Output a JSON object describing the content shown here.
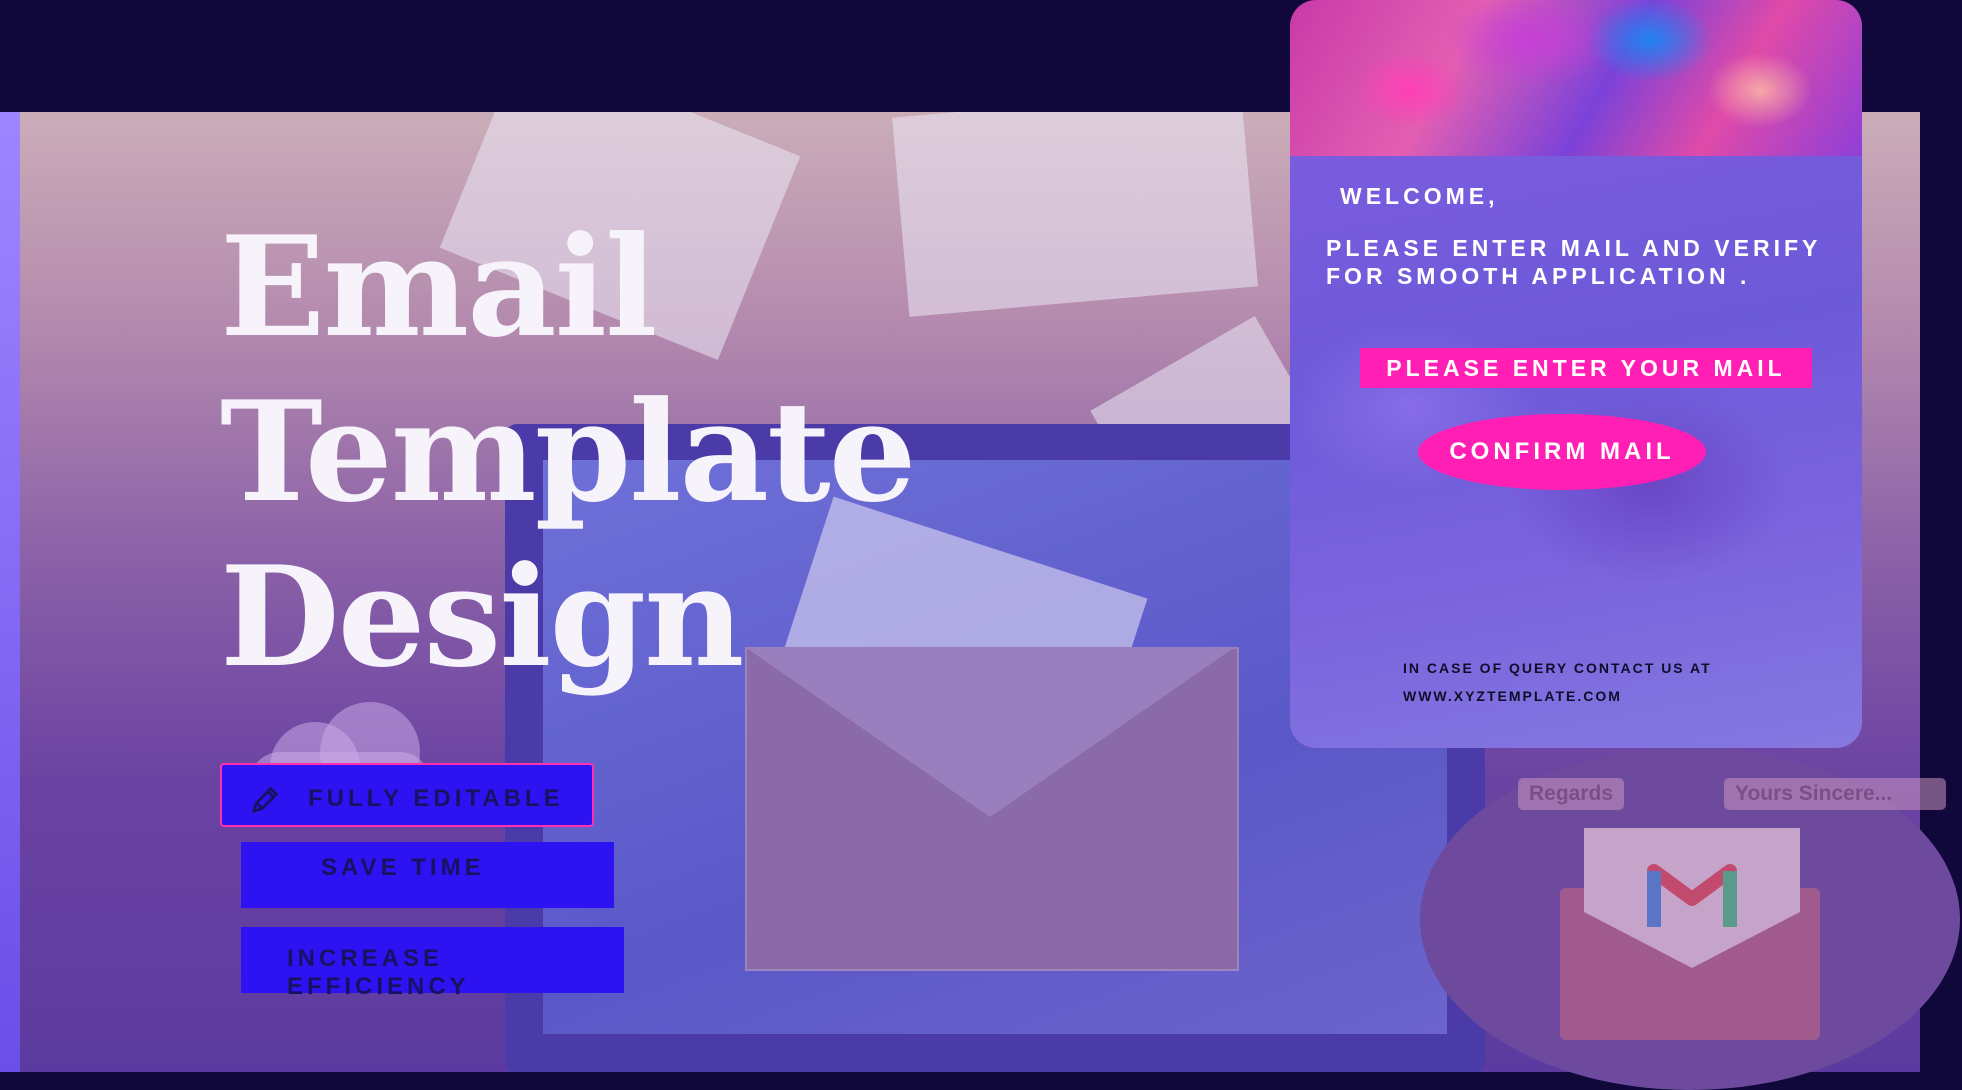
{
  "title": {
    "line1": "Email",
    "line2": "Template",
    "line3": "Design"
  },
  "features": {
    "fully_editable": "FULLY EDITABLE",
    "save_time": "SAVE TIME",
    "increase_efficiency": "INCREASE EFFICIENCY"
  },
  "card": {
    "welcome": "WELCOME,",
    "instruction_line1": "PLEASE ENTER MAIL AND VERIFY",
    "instruction_line2": "FOR SMOOTH APPLICATION .",
    "mail_placeholder": "PLEASE ENTER YOUR MAIL",
    "confirm_button": "CONFIRM MAIL",
    "contact_line1": "IN CASE OF QUERY CONTACT US AT",
    "contact_line2": "WWW.XYZTEMPLATE.COM"
  },
  "illustration": {
    "tag_regards": "Regards",
    "tag_sincerely": "Yours Sincere..."
  },
  "icons": [
    "pencil-icon",
    "gmail-icon"
  ],
  "colors": {
    "background": "#10073a",
    "feature_blue": "#2d12f2",
    "accent_pink": "#ff1fb4",
    "title_white": "#f7f3fb"
  }
}
